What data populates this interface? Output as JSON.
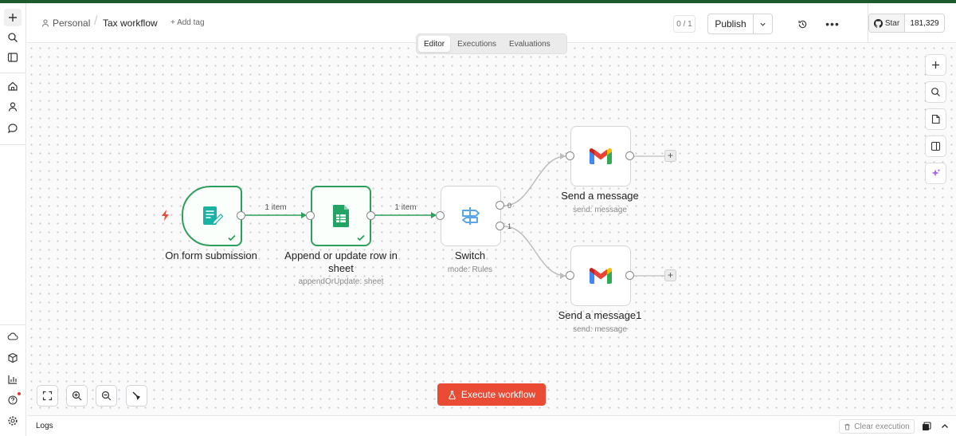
{
  "header": {
    "project": "Personal",
    "workflow_title": "Tax workflow",
    "add_tag": "+ Add tag",
    "counter": "0 / 1",
    "publish": "Publish",
    "star_label": "Star",
    "star_count": "181,329"
  },
  "tabs": [
    {
      "label": "Editor",
      "active": true
    },
    {
      "label": "Executions",
      "active": false
    },
    {
      "label": "Evaluations",
      "active": false
    }
  ],
  "nodes": [
    {
      "name": "On form submission",
      "subtitle": "",
      "icon": "form-icon",
      "status": "success"
    },
    {
      "name": "Append or update row in sheet",
      "subtitle": "appendOrUpdate: sheet",
      "icon": "google-sheets-icon",
      "status": "success"
    },
    {
      "name": "Switch",
      "subtitle": "mode: Rules",
      "icon": "signpost-icon",
      "status": ""
    },
    {
      "name": "Send a message",
      "subtitle": "send: message",
      "icon": "gmail-icon",
      "status": ""
    },
    {
      "name": "Send a message1",
      "subtitle": "send: message",
      "icon": "gmail-icon",
      "status": ""
    }
  ],
  "connections": {
    "form_to_sheet": "1 item",
    "sheet_to_switch": "1 item",
    "switch_output_0": "0",
    "switch_output_1": "1"
  },
  "canvas": {
    "execute_button": "Execute workflow",
    "add_plus": "+"
  },
  "logs": {
    "title": "Logs",
    "clear": "Clear execution"
  },
  "colors": {
    "accent": "#ea4b35",
    "success": "#2e9f5b",
    "top_line": "#1d5b2f"
  }
}
